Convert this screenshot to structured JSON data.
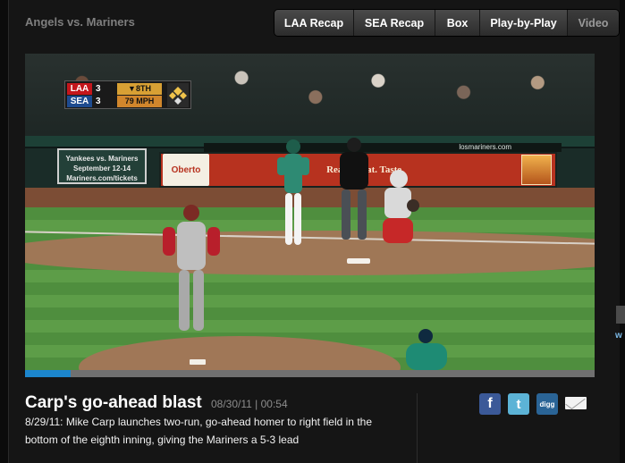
{
  "header": {
    "title": "Angels vs. Mariners",
    "tabs": [
      {
        "label": "LAA Recap",
        "active": false
      },
      {
        "label": "SEA Recap",
        "active": false
      },
      {
        "label": "Box",
        "active": false
      },
      {
        "label": "Play-by-Play",
        "active": false
      },
      {
        "label": "Video",
        "active": true
      }
    ]
  },
  "video": {
    "wall_sign": "Yankees vs. Mariners September 12-14 Mariners.com/tickets",
    "url_strip": "losmariners.com",
    "ad_logo": "Oberto",
    "ad_text": "Real.  Great.  Taste.",
    "scorebug": {
      "away_team": "LAA",
      "away_score": "3",
      "home_team": "SEA",
      "home_score": "3",
      "inning": "▼8TH",
      "pitch_speed": "79 MPH"
    },
    "progress": 0.08
  },
  "clip": {
    "title": "Carp's go-ahead blast",
    "date": "08/30/11",
    "duration": "00:54",
    "description": "8/29/11: Mike Carp launches two-run, go-ahead homer to right field in the bottom of the eighth inning, giving the Mariners a 5-3 lead"
  },
  "share": {
    "facebook_icon": "f",
    "twitter_icon": "t",
    "digg_label": "digg"
  },
  "sidebar": {
    "more_label": "w"
  },
  "colors": {
    "progress_fill": "#1c86cd",
    "facebook": "#3b5998",
    "twitter": "#5cb3d6",
    "digg": "#2a6496"
  }
}
